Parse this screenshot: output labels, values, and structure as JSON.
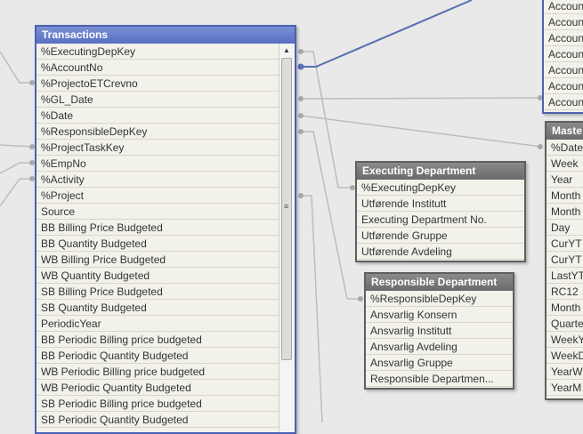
{
  "transactions": {
    "title": "Transactions",
    "fields": [
      "%ExecutingDepKey",
      "%AccountNo",
      "%ProjectoETCrevno",
      "%GL_Date",
      "%Date",
      "%ResponsibleDepKey",
      "%ProjectTaskKey",
      "%EmpNo",
      "%Activity",
      "%Project",
      "Source",
      "BB Billing Price Budgeted",
      "BB Quantity Budgeted",
      "WB Billing Price Budgeted",
      "WB Quantity Budgeted",
      "SB Billing Price Budgeted",
      "SB Quantity Budgeted",
      "PeriodicYear",
      "BB Periodic Billing price budgeted",
      "BB Periodic Quantity Budgeted",
      "WB Periodic Billing price budgeted",
      "WB Periodic Quantity Budgeted",
      "SB Periodic Billing price budgeted",
      "SB Periodic Quantity Budgeted"
    ]
  },
  "account": {
    "fields": [
      "Accoun",
      "Accoun",
      "Accoun",
      "Accoun",
      "Accoun",
      "Accoun",
      "Accoun"
    ]
  },
  "master": {
    "title": "Maste",
    "fields": [
      "%Date",
      "Week",
      "Year",
      "Month",
      "Month",
      "Day",
      "CurYT",
      "CurYT",
      "LastYT",
      "RC12",
      "Month",
      "Quarte",
      "WeekY",
      "WeekD",
      "YearW",
      "YearM"
    ]
  },
  "executing": {
    "title": "Executing Department",
    "fields": [
      "%ExecutingDepKey",
      "Utførende Institutt",
      "Executing Department No.",
      "Utførende Gruppe",
      "Utførende Avdeling"
    ]
  },
  "responsible": {
    "title": "Responsible Department",
    "fields": [
      "%ResponsibleDepKey",
      "Ansvarlig Konsern",
      "Ansvarlig Institutt",
      "Ansvarlig Avdeling",
      "Ansvarlig Gruppe",
      "Responsible Departmen..."
    ]
  },
  "colors": {
    "blue_header": "#5870c2",
    "gray_header": "#6a6a6a",
    "link_line": "#bdbdbd",
    "active_link": "#5a6fb0"
  }
}
